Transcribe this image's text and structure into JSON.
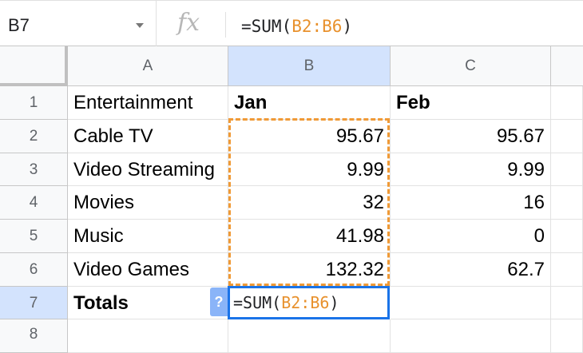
{
  "formula_bar": {
    "cell_ref": "B7",
    "fx_label": "fx",
    "formula_prefix": "=SUM(",
    "formula_range": "B2:B6",
    "formula_suffix": ")"
  },
  "columns": [
    "A",
    "B",
    "C"
  ],
  "rows": [
    "1",
    "2",
    "3",
    "4",
    "5",
    "6",
    "7",
    "8"
  ],
  "cells": {
    "A1": "Entertainment",
    "B1": "Jan",
    "C1": "Feb",
    "A2": "Cable TV",
    "B2": "95.67",
    "C2": "95.67",
    "A3": "Video Streaming",
    "B3": "9.99",
    "C3": "9.99",
    "A4": "Movies",
    "B4": "32",
    "C4": "16",
    "A5": "Music",
    "B5": "41.98",
    "C5": "0",
    "A6": "Video Games",
    "B6": "132.32",
    "C6": "62.7",
    "A7": "Totals"
  },
  "editor": {
    "help_label": "?",
    "formula_prefix": "=SUM(",
    "formula_range": "B2:B6",
    "formula_suffix": ")"
  },
  "colors": {
    "range_highlight": "#f09a36",
    "active_border": "#1a73e8",
    "selected_header": "#d3e3fd"
  }
}
